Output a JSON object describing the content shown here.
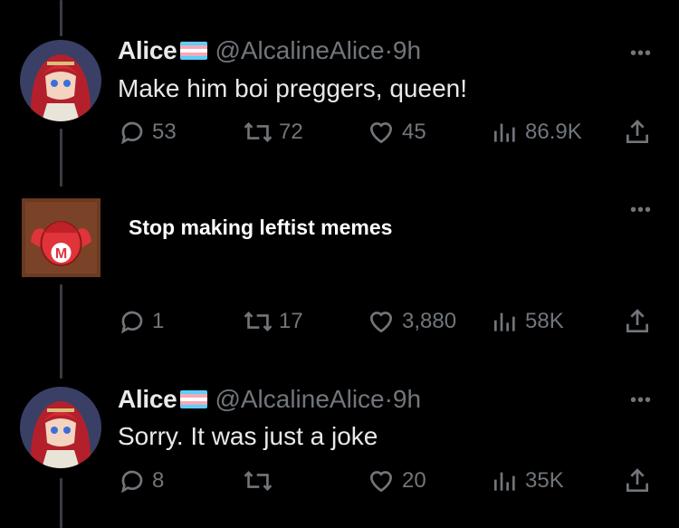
{
  "tweets": [
    {
      "name": "Alice",
      "handle": "@AlcalineAlice",
      "time": "·9h",
      "text": "Make him boi preggers, queen!",
      "replies": "53",
      "reposts": "72",
      "likes": "45",
      "views": "86.9K"
    },
    {
      "text": "Stop making leftist memes",
      "replies": "1",
      "reposts": "17",
      "likes": "3,880",
      "views": "58K"
    },
    {
      "name": "Alice",
      "handle": "@AlcalineAlice",
      "time": "·9h",
      "text": "Sorry. It was just a joke",
      "replies": "8",
      "reposts": "",
      "likes": "20",
      "views": "35K"
    }
  ],
  "more_label": "•••",
  "colors": {
    "background": "#000000",
    "text": "#e7e9ea",
    "muted": "#71767b",
    "thread_line": "#3a3d41"
  },
  "icons": [
    "reply-icon",
    "repost-icon",
    "like-icon",
    "views-icon",
    "share-icon",
    "more-icon",
    "trans-flag-icon"
  ]
}
